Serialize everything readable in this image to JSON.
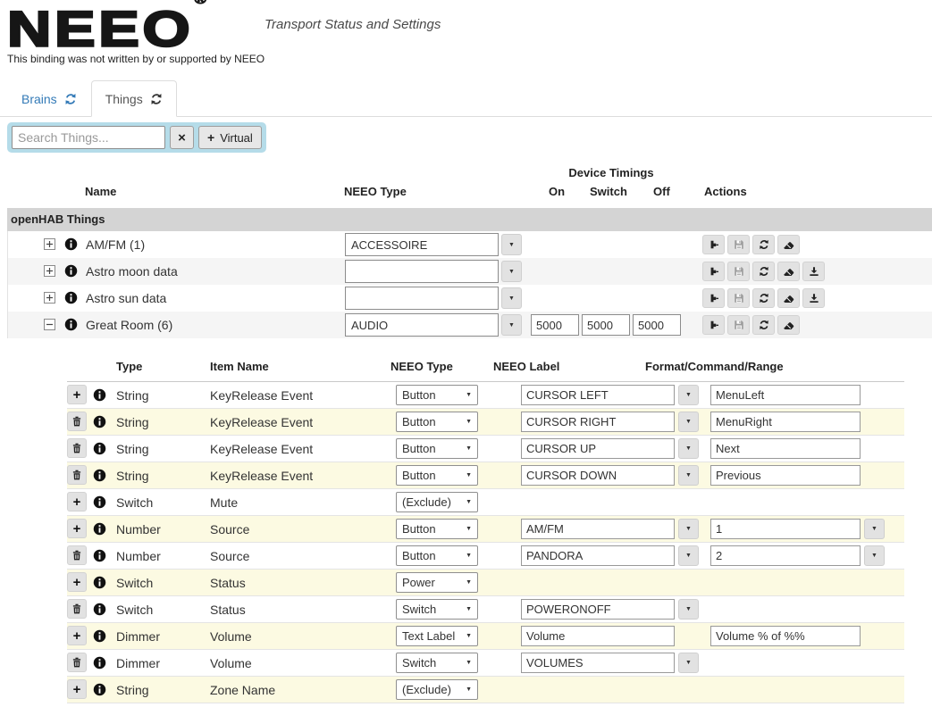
{
  "icons": {
    "caret_down": "▼",
    "plus": "+",
    "clear": "×"
  },
  "header": {
    "logo": "NEEO",
    "registered": "®",
    "title": "Transport Status and Settings",
    "disclaimer": "This binding was not written by or supported by NEEO"
  },
  "tabs": [
    {
      "label": "Brains"
    },
    {
      "label": "Things"
    }
  ],
  "toolbar": {
    "search_placeholder": "Search Things...",
    "virtual_label": "Virtual"
  },
  "things_table": {
    "group_header": "Device Timings",
    "columns": {
      "name": "Name",
      "neeo_type": "NEEO Type",
      "on": "On",
      "switch": "Switch",
      "off": "Off",
      "actions": "Actions"
    },
    "section_header": "openHAB Things",
    "rows": [
      {
        "name": "AM/FM (1)",
        "neeo_type": "ACCESSOIRE",
        "expanded": false,
        "timings": null,
        "actions": [
          "hammer",
          "save",
          "refresh",
          "eraser"
        ]
      },
      {
        "name": "Astro moon data",
        "neeo_type": "",
        "expanded": false,
        "timings": null,
        "actions": [
          "hammer",
          "save",
          "refresh",
          "eraser",
          "download"
        ]
      },
      {
        "name": "Astro sun data",
        "neeo_type": "",
        "expanded": false,
        "timings": null,
        "actions": [
          "hammer",
          "save",
          "refresh",
          "eraser",
          "download"
        ]
      },
      {
        "name": "Great Room (6)",
        "neeo_type": "AUDIO",
        "expanded": true,
        "timings": {
          "on": "5000",
          "switch": "5000",
          "off": "5000"
        },
        "actions": [
          "hammer",
          "save",
          "refresh",
          "eraser"
        ]
      }
    ]
  },
  "channels_table": {
    "columns": {
      "type": "Type",
      "item_name": "Item Name",
      "neeo_type": "NEEO Type",
      "neeo_label": "NEEO Label",
      "format": "Format/Command/Range"
    },
    "rows": [
      {
        "btn": "add",
        "type": "String",
        "item": "KeyRelease Event",
        "neeo_type": "Button",
        "label": "CURSOR LEFT",
        "label_dd": true,
        "format": "MenuLeft",
        "format_dd": false
      },
      {
        "btn": "delete",
        "type": "String",
        "item": "KeyRelease Event",
        "neeo_type": "Button",
        "label": "CURSOR RIGHT",
        "label_dd": true,
        "format": "MenuRight",
        "format_dd": false
      },
      {
        "btn": "delete",
        "type": "String",
        "item": "KeyRelease Event",
        "neeo_type": "Button",
        "label": "CURSOR UP",
        "label_dd": true,
        "format": "Next",
        "format_dd": false
      },
      {
        "btn": "delete",
        "type": "String",
        "item": "KeyRelease Event",
        "neeo_type": "Button",
        "label": "CURSOR DOWN",
        "label_dd": true,
        "format": "Previous",
        "format_dd": false
      },
      {
        "btn": "add",
        "type": "Switch",
        "item": "Mute",
        "neeo_type": "(Exclude)",
        "label": null,
        "label_dd": false,
        "format": null,
        "format_dd": false
      },
      {
        "btn": "add",
        "type": "Number",
        "item": "Source",
        "neeo_type": "Button",
        "label": "AM/FM",
        "label_dd": true,
        "format": "1",
        "format_dd": true
      },
      {
        "btn": "delete",
        "type": "Number",
        "item": "Source",
        "neeo_type": "Button",
        "label": "PANDORA",
        "label_dd": true,
        "format": "2",
        "format_dd": true
      },
      {
        "btn": "add",
        "type": "Switch",
        "item": "Status",
        "neeo_type": "Power",
        "label": null,
        "label_dd": false,
        "format": null,
        "format_dd": false
      },
      {
        "btn": "delete",
        "type": "Switch",
        "item": "Status",
        "neeo_type": "Switch",
        "label": "POWERONOFF",
        "label_dd": true,
        "format": null,
        "format_dd": false
      },
      {
        "btn": "add",
        "type": "Dimmer",
        "item": "Volume",
        "neeo_type": "Text Label",
        "label": "Volume",
        "label_dd": false,
        "format": "Volume % of %%",
        "format_dd": false
      },
      {
        "btn": "delete",
        "type": "Dimmer",
        "item": "Volume",
        "neeo_type": "Switch",
        "label": "VOLUMES",
        "label_dd": true,
        "format": null,
        "format_dd": false
      },
      {
        "btn": "add",
        "type": "String",
        "item": "Zone Name",
        "neeo_type": "(Exclude)",
        "label": null,
        "label_dd": false,
        "format": null,
        "format_dd": false
      }
    ]
  }
}
